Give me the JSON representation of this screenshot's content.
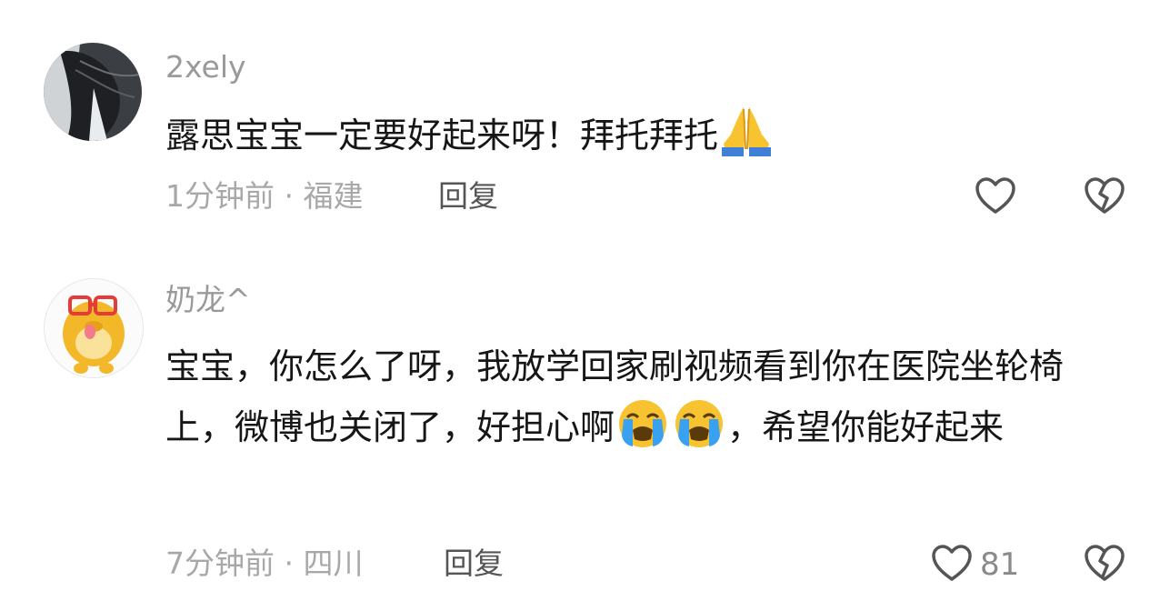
{
  "comments": [
    {
      "username": "2xely",
      "text": "露思宝宝一定要好起来呀！拜托拜托",
      "emoji": "folded-hands",
      "time": "1分钟前",
      "location": "福建",
      "meta_separator": " · ",
      "reply_label": "回复",
      "like_count": ""
    },
    {
      "username": "奶龙^",
      "text_part1": "宝宝，你怎么了呀，我放学回家刷视频看到你在医院坐轮椅上，微博也关闭了，好担心啊",
      "text_part2": "，希望你能好起来",
      "emoji": "loudly-crying-face",
      "time": "7分钟前",
      "location": "四川",
      "meta_separator": " · ",
      "reply_label": "回复",
      "like_count": "81"
    }
  ],
  "colors": {
    "username": "#9a9a9a",
    "text": "#161616",
    "meta": "#a8a8a8",
    "reply": "#555555",
    "icon": "#555555",
    "emoji_yellow": "#f7c331",
    "emoji_tear": "#3aa0f0"
  }
}
